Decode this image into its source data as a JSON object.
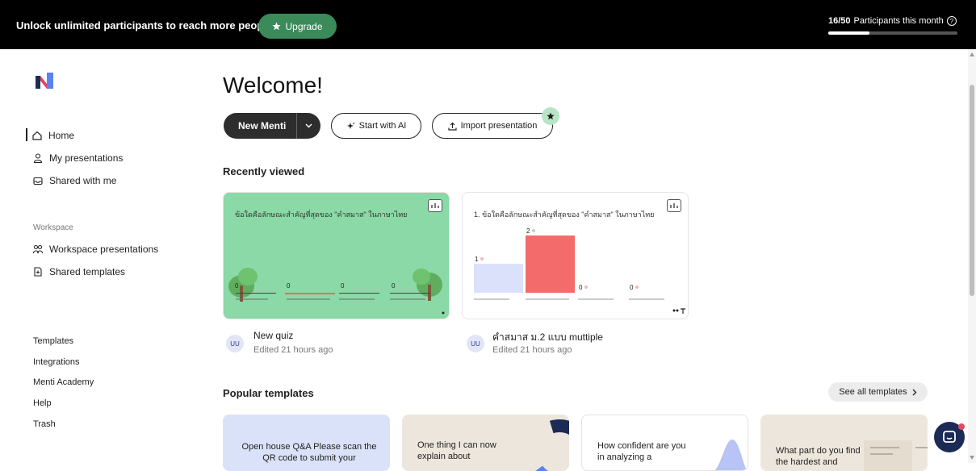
{
  "banner": {
    "message": "Unlock unlimited participants to reach more people.",
    "upgrade_label": "Upgrade",
    "participants_count": "16/50",
    "participants_label": "Participants this month",
    "participants_progress": 0.32
  },
  "sidebar": {
    "items": [
      {
        "label": "Home",
        "icon": "home-icon",
        "active": true
      },
      {
        "label": "My presentations",
        "icon": "user-icon"
      },
      {
        "label": "Shared with me",
        "icon": "inbox-icon"
      }
    ],
    "workspace_label": "Workspace",
    "workspace_items": [
      {
        "label": "Workspace presentations",
        "icon": "users-icon"
      },
      {
        "label": "Shared templates",
        "icon": "template-icon"
      }
    ],
    "links": [
      "Templates",
      "Integrations",
      "Menti Academy",
      "Help",
      "Trash"
    ]
  },
  "main": {
    "title": "Welcome!",
    "new_menti_label": "New Menti",
    "start_ai_label": "Start with AI",
    "import_label": "Import presentation",
    "recently_viewed_label": "Recently viewed",
    "recent": [
      {
        "title": "New quiz",
        "meta": "Edited 21 hours ago",
        "avatar": "UU",
        "question": "ข้อใดคือลักษณะสำคัญที่สุดของ \"คำสมาส\" ในภาษาไทย",
        "counts": [
          "0",
          "0",
          "0",
          "0"
        ]
      },
      {
        "title": "คำสมาส ม.2 แบบ muttiple",
        "meta": "Edited 21 hours ago",
        "avatar": "UU",
        "question": "1. ข้อใดคือลักษณะสำคัญที่สุดของ \"คำสมาส\" ในภาษาไทย",
        "counts": [
          "1",
          "2",
          "0",
          "0"
        ]
      }
    ],
    "popular_label": "Popular templates",
    "see_all_label": "See all templates",
    "templates": [
      {
        "text": "Open house Q&A Please scan the QR code to submit your"
      },
      {
        "text": "One thing I can now explain about"
      },
      {
        "text": "How confident are you in analyzing a"
      },
      {
        "text": "What part do you find the hardest and"
      }
    ]
  },
  "colors": {
    "accent": "#3a8a5a",
    "topbar": "#000000",
    "card_green": "#8ad9a6",
    "bar_blue": "#dce1fb",
    "bar_red": "#f46b6b"
  }
}
